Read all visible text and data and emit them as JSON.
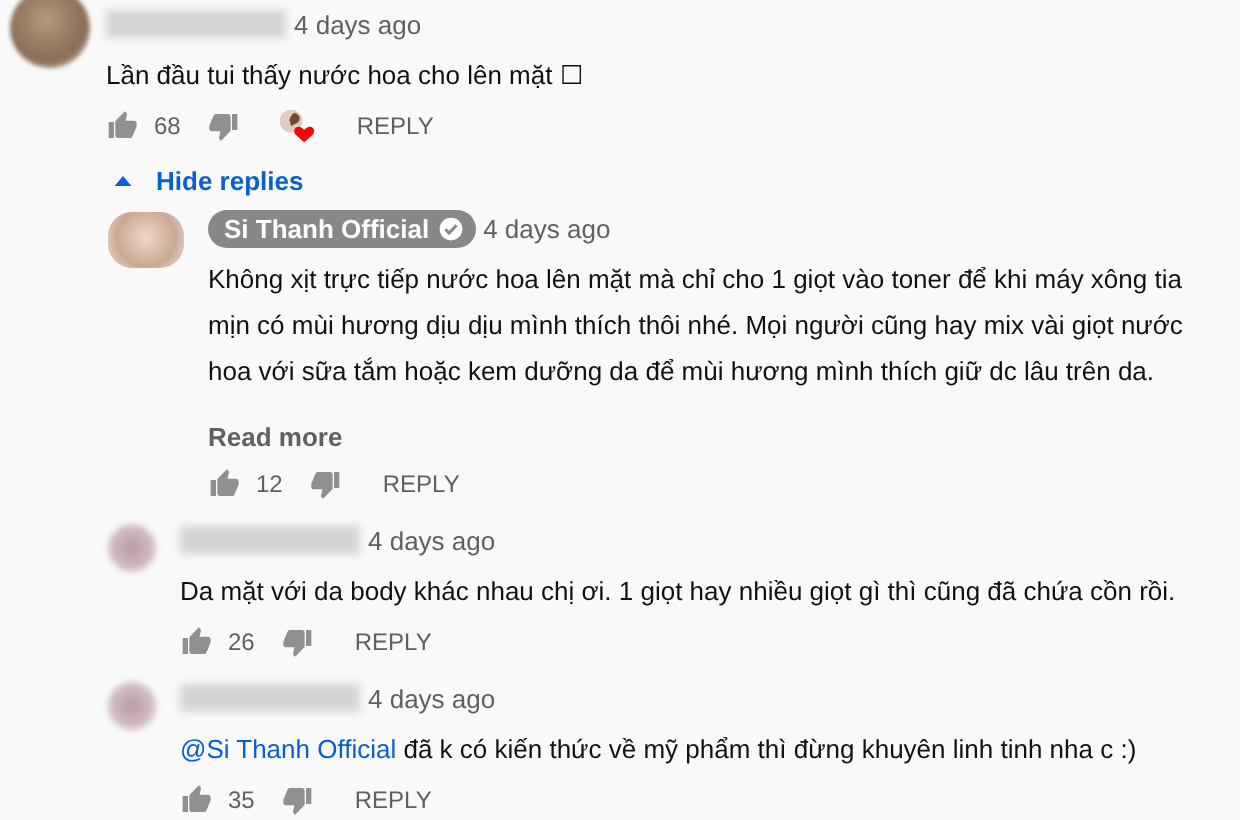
{
  "comment": {
    "author": {
      "kind": "blurred"
    },
    "time": "4 days ago",
    "text": "Lần đầu tui thấy nước hoa cho lên mặt ☐",
    "likes": "68",
    "creator_heart": true,
    "reply": "REPLY"
  },
  "toggle": {
    "label": "Hide replies",
    "expanded": true
  },
  "replies": [
    {
      "author": {
        "kind": "badge",
        "name": "Si Thanh Official",
        "verified": true
      },
      "time": "4 days ago",
      "text": "Không xịt trực tiếp nước hoa lên mặt mà chỉ cho 1 giọt vào toner để khi máy xông tia mịn có mùi hương dịu dịu mình thích thôi nhé. Mọi người cũng hay mix vài giọt nước hoa với sữa tắm hoặc kem dưỡng da để mùi hương mình thích giữ dc lâu trên da.",
      "read_more": "Read more",
      "likes": "12",
      "reply": "REPLY"
    },
    {
      "author": {
        "kind": "blurred"
      },
      "time": "4 days ago",
      "text": "Da mặt với da body khác nhau chị ơi. 1 giọt hay nhiều giọt gì thì cũng đã chứa cồn rồi.",
      "likes": "26",
      "reply": "REPLY"
    },
    {
      "author": {
        "kind": "blurred"
      },
      "time": "4 days ago",
      "mention": "@Si Thanh Official",
      "text": " đã k có kiến thức về mỹ phẩm thì đừng khuyên linh tinh nha c  :)",
      "likes": "35",
      "reply": "REPLY"
    }
  ]
}
